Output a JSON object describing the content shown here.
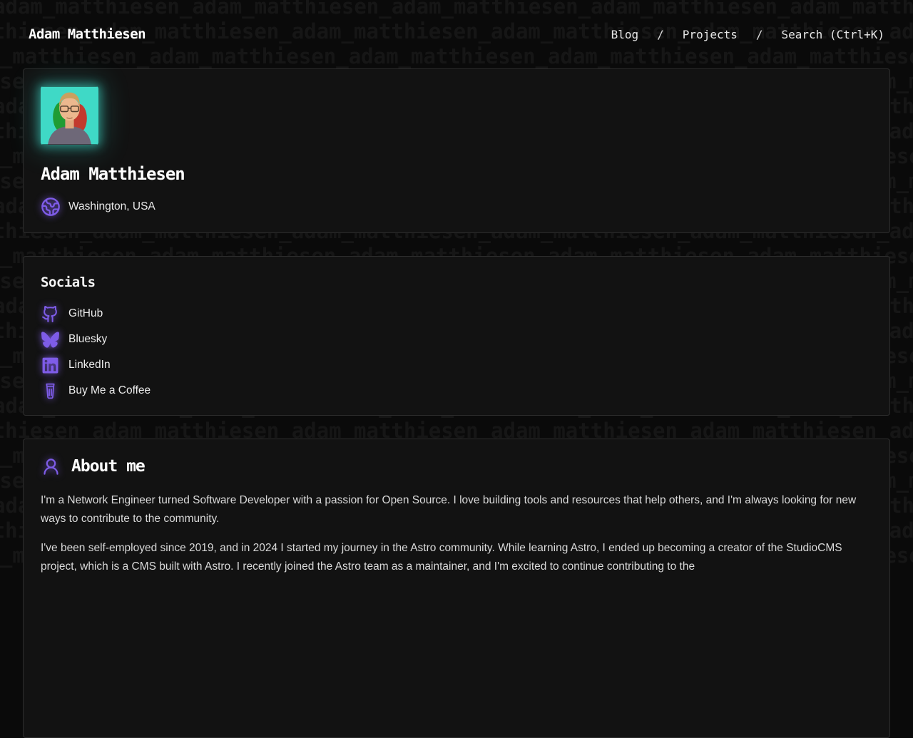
{
  "page": {
    "background_text": "adam_matthiesen_",
    "background_rows": 24,
    "colors": {
      "page_bg": "#0a0a0a",
      "card_bg": "#121212",
      "card_border": "#2d2d2d",
      "accent_purple": "#7e5ce8",
      "avatar_glow_teal": "#40e0d0",
      "text_primary": "#ffffff",
      "text_body": "#d9d9d9"
    }
  },
  "header": {
    "title": "Adam Matthiesen",
    "separator": "/",
    "nav": [
      {
        "label": "Blog"
      },
      {
        "label": "Projects"
      },
      {
        "label": "Search (Ctrl+K)"
      }
    ]
  },
  "profile": {
    "name": "Adam Matthiesen",
    "location": "Washington, USA",
    "location_icon": "globe-icon",
    "avatar": "portrait photo of Adam on teal background with red and green silhouette offsets"
  },
  "socials": {
    "heading": "Socials",
    "links": [
      {
        "label": "GitHub",
        "icon": "github-icon"
      },
      {
        "label": "Bluesky",
        "icon": "bluesky-icon"
      },
      {
        "label": "LinkedIn",
        "icon": "linkedin-icon"
      },
      {
        "label": "Buy Me a Coffee",
        "icon": "coffee-cup-icon"
      }
    ]
  },
  "about": {
    "heading": "About me",
    "icon": "user-icon",
    "paragraphs": [
      "I'm a Network Engineer turned Software Developer with a passion for Open Source. I love building tools and resources that help others, and I'm always looking for new ways to contribute to the community.",
      "I've been self-employed since 2019, and in 2024 I started my journey in the Astro community. While learning Astro, I ended up becoming a creator of the StudioCMS project, which is a CMS built with Astro. I recently joined the Astro team as a maintainer, and I'm excited to continue contributing to the"
    ]
  }
}
